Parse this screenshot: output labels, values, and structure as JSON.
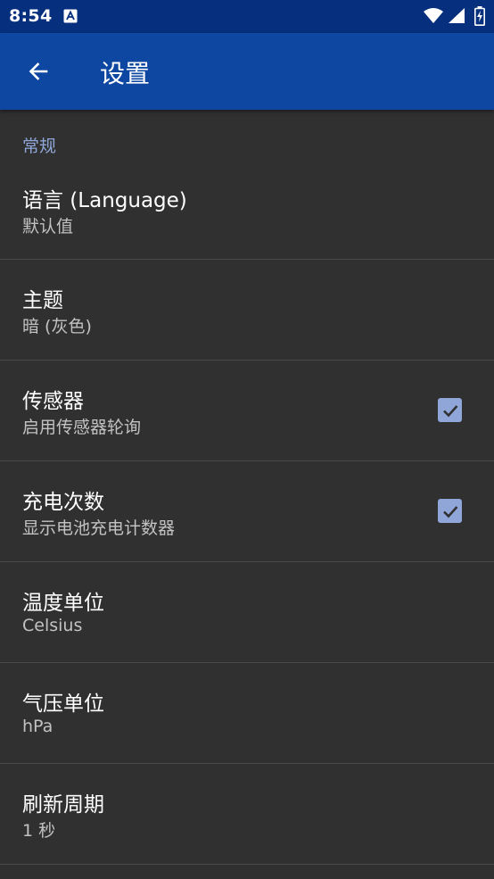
{
  "status_bar": {
    "time": "8:54",
    "icons": [
      "notification-a-icon",
      "wifi-icon",
      "signal-icon",
      "battery-charging-icon"
    ]
  },
  "app_bar": {
    "title": "设置",
    "back_icon": "arrow-back-icon"
  },
  "settings": {
    "category": "常规",
    "items": [
      {
        "title": "语言 (Language)",
        "summary": "默认值",
        "checkbox": null
      },
      {
        "title": "主题",
        "summary": "暗 (灰色)",
        "checkbox": null
      },
      {
        "title": "传感器",
        "summary": "启用传感器轮询",
        "checkbox": true
      },
      {
        "title": "充电次数",
        "summary": "显示电池充电计数器",
        "checkbox": true
      },
      {
        "title": "温度单位",
        "summary": "Celsius",
        "checkbox": null
      },
      {
        "title": "气压单位",
        "summary": "hPa",
        "checkbox": null
      },
      {
        "title": "刷新周期",
        "summary": "1 秒",
        "checkbox": null
      }
    ]
  },
  "colors": {
    "status_bar": "#062f7d",
    "app_bar": "#0d47a1",
    "background": "#303030",
    "accent": "#90a6d9",
    "category_text": "#8fa7d8",
    "divider": "#4a4a4a"
  }
}
